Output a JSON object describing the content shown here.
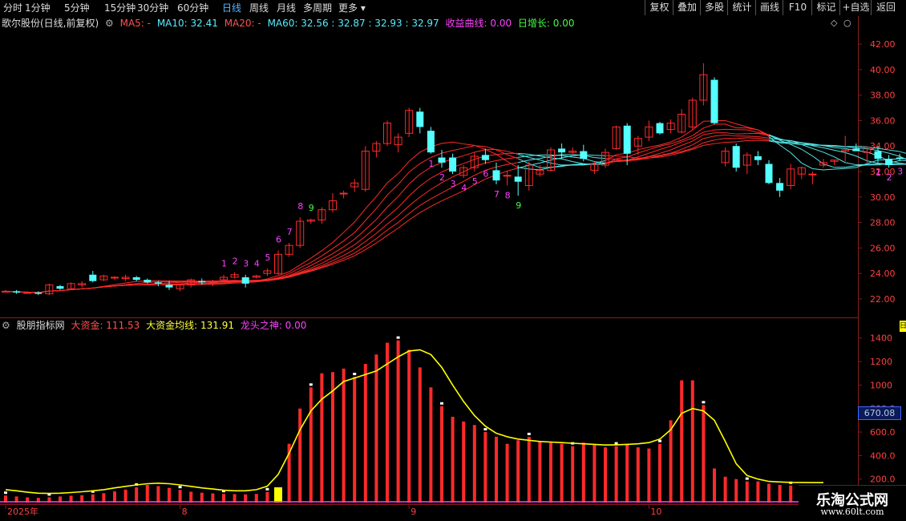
{
  "toolbar": {
    "periods": [
      "分时",
      "1分钟",
      "5分钟",
      "15分钟",
      "30分钟",
      "60分钟",
      "日线",
      "周线",
      "月线",
      "多周期",
      "更多"
    ],
    "active_period": "日线",
    "buttons": [
      "复权",
      "叠加",
      "多股",
      "统计",
      "画线",
      "F10",
      "标记",
      "+自选",
      "返回"
    ]
  },
  "main_legend": {
    "title": "歌尔股份(日线,前复权)",
    "ma5": "MA5: -",
    "ma10": "MA10: 32.41",
    "ma20": "MA20: -",
    "ma60": "MA60: 32.56 : 32.87 : 32.93 : 32.97",
    "profit": "收益曲线: 0.00",
    "daily": "日增长: 0.00"
  },
  "sub_legend": {
    "title": "股朋指标网",
    "big_fund": "大资金: 111.53",
    "big_fund_avg": "大资金均线: 131.91",
    "dragon": "龙头之神: 0.00"
  },
  "price_axis": [
    "42.00",
    "40.00",
    "38.00",
    "36.00",
    "34.00",
    "32.00",
    "30.00",
    "28.00",
    "26.00",
    "24.00",
    "22.00"
  ],
  "volume_axis": [
    "1400",
    "1200",
    "1000",
    "800.0",
    "600.0",
    "400.0",
    "200.0"
  ],
  "cursor_value": "670.08",
  "date_labels": [
    {
      "text": "2025年",
      "i": 0
    },
    {
      "text": "8",
      "i": 16
    },
    {
      "text": "9",
      "i": 37
    },
    {
      "text": "10",
      "i": 59
    }
  ],
  "right_strip": "日",
  "watermark": {
    "line1": "乐淘公式网",
    "line2": "www.60lt.com"
  },
  "colors": {
    "up": "#ff2a2a",
    "down": "#54ffff",
    "yellow": "#ffff00",
    "magenta": "#ff40ff",
    "green": "#40ff40",
    "axis": "#8b1a1a"
  },
  "chart_data": {
    "type": "candlestick",
    "candles": [
      [
        22.6,
        22.7,
        22.5,
        22.6
      ],
      [
        22.6,
        22.7,
        22.4,
        22.5
      ],
      [
        22.5,
        22.6,
        22.4,
        22.5
      ],
      [
        22.5,
        22.6,
        22.3,
        22.4
      ],
      [
        22.4,
        23.2,
        22.3,
        23.1
      ],
      [
        23.0,
        23.1,
        22.7,
        22.8
      ],
      [
        22.8,
        23.3,
        22.7,
        23.2
      ],
      [
        23.1,
        23.4,
        22.9,
        23.2
      ],
      [
        23.9,
        24.2,
        23.3,
        23.4
      ],
      [
        23.5,
        23.9,
        23.4,
        23.8
      ],
      [
        23.7,
        23.8,
        23.5,
        23.7
      ],
      [
        23.6,
        23.9,
        23.4,
        23.7
      ],
      [
        23.7,
        23.8,
        23.4,
        23.5
      ],
      [
        23.5,
        23.6,
        23.2,
        23.3
      ],
      [
        23.3,
        23.4,
        23.0,
        23.2
      ],
      [
        23.1,
        23.4,
        22.7,
        22.9
      ],
      [
        22.8,
        23.2,
        22.6,
        23.1
      ],
      [
        23.1,
        23.6,
        22.9,
        23.5
      ],
      [
        23.4,
        23.6,
        23.1,
        23.3
      ],
      [
        23.2,
        23.5,
        23.0,
        23.4
      ],
      [
        23.5,
        23.9,
        23.3,
        23.7
      ],
      [
        23.7,
        24.1,
        23.6,
        23.9
      ],
      [
        23.7,
        23.9,
        22.9,
        23.2
      ],
      [
        23.7,
        23.9,
        23.6,
        23.8
      ],
      [
        24.0,
        24.4,
        23.8,
        24.2
      ],
      [
        24.0,
        25.8,
        23.9,
        25.5
      ],
      [
        25.5,
        26.4,
        25.3,
        26.2
      ],
      [
        26.2,
        28.4,
        26.0,
        28.1
      ],
      [
        28.1,
        28.3,
        27.9,
        28.2
      ],
      [
        28.2,
        29.2,
        27.9,
        29.0
      ],
      [
        29.0,
        30.3,
        28.8,
        29.7
      ],
      [
        30.3,
        30.5,
        29.9,
        30.3
      ],
      [
        30.8,
        31.4,
        30.4,
        31.1
      ],
      [
        30.6,
        34.0,
        30.4,
        33.6
      ],
      [
        33.6,
        34.4,
        33.1,
        34.2
      ],
      [
        34.2,
        36.0,
        34.0,
        35.8
      ],
      [
        34.1,
        35.0,
        33.5,
        34.7
      ],
      [
        35.0,
        37.0,
        34.7,
        36.8
      ],
      [
        36.7,
        37.0,
        35.0,
        35.5
      ],
      [
        35.2,
        35.5,
        33.4,
        33.5
      ],
      [
        33.1,
        33.7,
        32.3,
        32.7
      ],
      [
        33.1,
        33.4,
        31.8,
        32.0
      ],
      [
        31.7,
        32.5,
        31.5,
        32.3
      ],
      [
        32.3,
        33.5,
        32.0,
        33.2
      ],
      [
        33.3,
        33.8,
        32.6,
        32.9
      ],
      [
        32.1,
        32.7,
        31.0,
        31.3
      ],
      [
        31.7,
        32.0,
        30.9,
        31.7
      ],
      [
        31.6,
        32.5,
        30.1,
        31.2
      ],
      [
        30.9,
        32.8,
        30.5,
        32.5
      ],
      [
        31.8,
        32.5,
        31.6,
        32.1
      ],
      [
        32.1,
        33.9,
        32.0,
        33.7
      ],
      [
        33.8,
        34.2,
        33.0,
        33.5
      ],
      [
        33.5,
        33.9,
        33.3,
        33.6
      ],
      [
        33.6,
        34.1,
        32.8,
        33.0
      ],
      [
        32.1,
        32.8,
        31.8,
        32.6
      ],
      [
        32.5,
        33.8,
        32.3,
        33.5
      ],
      [
        33.8,
        35.6,
        33.7,
        35.5
      ],
      [
        35.6,
        35.8,
        32.5,
        33.4
      ],
      [
        34.0,
        34.8,
        33.3,
        34.6
      ],
      [
        34.7,
        36.0,
        34.4,
        35.5
      ],
      [
        35.8,
        35.9,
        34.9,
        35.0
      ],
      [
        35.3,
        36.1,
        35.0,
        35.8
      ],
      [
        35.1,
        36.9,
        35.0,
        36.5
      ],
      [
        35.5,
        37.8,
        35.3,
        37.6
      ],
      [
        37.6,
        40.5,
        37.2,
        39.6
      ],
      [
        39.2,
        39.4,
        35.7,
        35.8
      ],
      [
        32.7,
        33.9,
        32.4,
        33.6
      ],
      [
        34.0,
        34.2,
        32.0,
        32.3
      ],
      [
        32.5,
        33.5,
        31.8,
        33.3
      ],
      [
        33.2,
        33.6,
        32.5,
        32.9
      ],
      [
        32.6,
        32.9,
        31.0,
        31.1
      ],
      [
        31.1,
        31.5,
        30.0,
        30.5
      ],
      [
        30.9,
        32.6,
        30.6,
        32.2
      ],
      [
        31.8,
        32.4,
        31.4,
        32.3
      ],
      [
        31.8,
        32.0,
        31.0,
        31.8
      ],
      [
        32.5,
        33.0,
        32.3,
        32.7
      ],
      [
        32.8,
        32.9,
        32.5,
        32.9
      ],
      [
        33.6,
        34.8,
        32.8,
        33.7
      ],
      [
        33.8,
        34.2,
        33.6,
        33.6
      ],
      [
        33.5,
        33.8,
        32.7,
        33.9
      ],
      [
        33.6,
        34.0,
        32.7,
        33.0
      ],
      [
        33.0,
        33.3,
        32.3,
        32.5
      ],
      [
        33.1,
        33.4,
        32.8,
        33.0
      ],
      [
        32.9,
        33.1,
        31.5,
        31.7
      ],
      [
        31.1,
        31.8,
        30.9,
        31.5
      ]
    ],
    "sub_values": [
      60,
      52,
      44,
      40,
      45,
      52,
      58,
      62,
      70,
      80,
      95,
      110,
      130,
      150,
      140,
      125,
      108,
      92,
      84,
      78,
      74,
      72,
      70,
      74,
      90,
      130,
      500,
      800,
      980,
      1100,
      1110,
      1140,
      1070,
      1180,
      1260,
      1360,
      1380,
      1300,
      1150,
      980,
      820,
      730,
      690,
      660,
      600,
      560,
      500,
      530,
      560,
      520,
      510,
      500,
      480,
      510,
      490,
      470,
      480,
      500,
      470,
      460,
      500,
      700,
      1040,
      1040,
      830,
      290,
      220,
      200,
      180,
      180,
      160,
      150,
      145,
      140,
      140,
      132
    ],
    "sub_avg": [
      110,
      100,
      88,
      80,
      78,
      80,
      85,
      92,
      100,
      110,
      125,
      138,
      150,
      160,
      165,
      160,
      150,
      138,
      125,
      115,
      105,
      100,
      100,
      110,
      140,
      240,
      420,
      620,
      780,
      880,
      950,
      1030,
      1060,
      1090,
      1120,
      1180,
      1240,
      1290,
      1300,
      1260,
      1150,
      1000,
      860,
      740,
      650,
      590,
      560,
      540,
      530,
      520,
      515,
      510,
      505,
      500,
      495,
      490,
      492,
      495,
      500,
      510,
      540,
      620,
      760,
      800,
      780,
      700,
      520,
      330,
      230,
      200,
      180,
      175,
      172,
      171,
      170,
      170
    ],
    "markers": [
      {
        "i": 20,
        "t": "1",
        "c": "magenta",
        "pos": "above"
      },
      {
        "i": 21,
        "t": "2",
        "c": "magenta",
        "pos": "above"
      },
      {
        "i": 22,
        "t": "3",
        "c": "magenta",
        "pos": "above"
      },
      {
        "i": 23,
        "t": "4",
        "c": "magenta",
        "pos": "above"
      },
      {
        "i": 24,
        "t": "5",
        "c": "magenta",
        "pos": "above"
      },
      {
        "i": 25,
        "t": "6",
        "c": "magenta",
        "pos": "above"
      },
      {
        "i": 26,
        "t": "7",
        "c": "magenta",
        "pos": "above"
      },
      {
        "i": 27,
        "t": "8",
        "c": "magenta",
        "pos": "above"
      },
      {
        "i": 28,
        "t": "9",
        "c": "green",
        "pos": "above"
      },
      {
        "i": 39,
        "t": "1",
        "c": "magenta",
        "pos": "below"
      },
      {
        "i": 40,
        "t": "2",
        "c": "magenta",
        "pos": "below"
      },
      {
        "i": 41,
        "t": "3",
        "c": "magenta",
        "pos": "below"
      },
      {
        "i": 42,
        "t": "4",
        "c": "magenta",
        "pos": "below"
      },
      {
        "i": 43,
        "t": "5",
        "c": "magenta",
        "pos": "below"
      },
      {
        "i": 44,
        "t": "6",
        "c": "magenta",
        "pos": "below"
      },
      {
        "i": 45,
        "t": "7",
        "c": "magenta",
        "pos": "below"
      },
      {
        "i": 46,
        "t": "8",
        "c": "magenta",
        "pos": "below"
      },
      {
        "i": 47,
        "t": "9",
        "c": "green",
        "pos": "below"
      },
      {
        "i": 80,
        "t": "1",
        "c": "magenta",
        "pos": "below"
      },
      {
        "i": 81,
        "t": "2",
        "c": "magenta",
        "pos": "below"
      },
      {
        "i": 82,
        "t": "3",
        "c": "magenta",
        "pos": "below"
      },
      {
        "i": 83,
        "t": "4",
        "c": "magenta",
        "pos": "below"
      },
      {
        "i": 84,
        "t": "5",
        "c": "magenta",
        "pos": "below"
      }
    ],
    "yellow_bar_index": 25,
    "price_range": [
      20.8,
      43.2
    ],
    "sub_range": [
      0,
      1480
    ]
  }
}
